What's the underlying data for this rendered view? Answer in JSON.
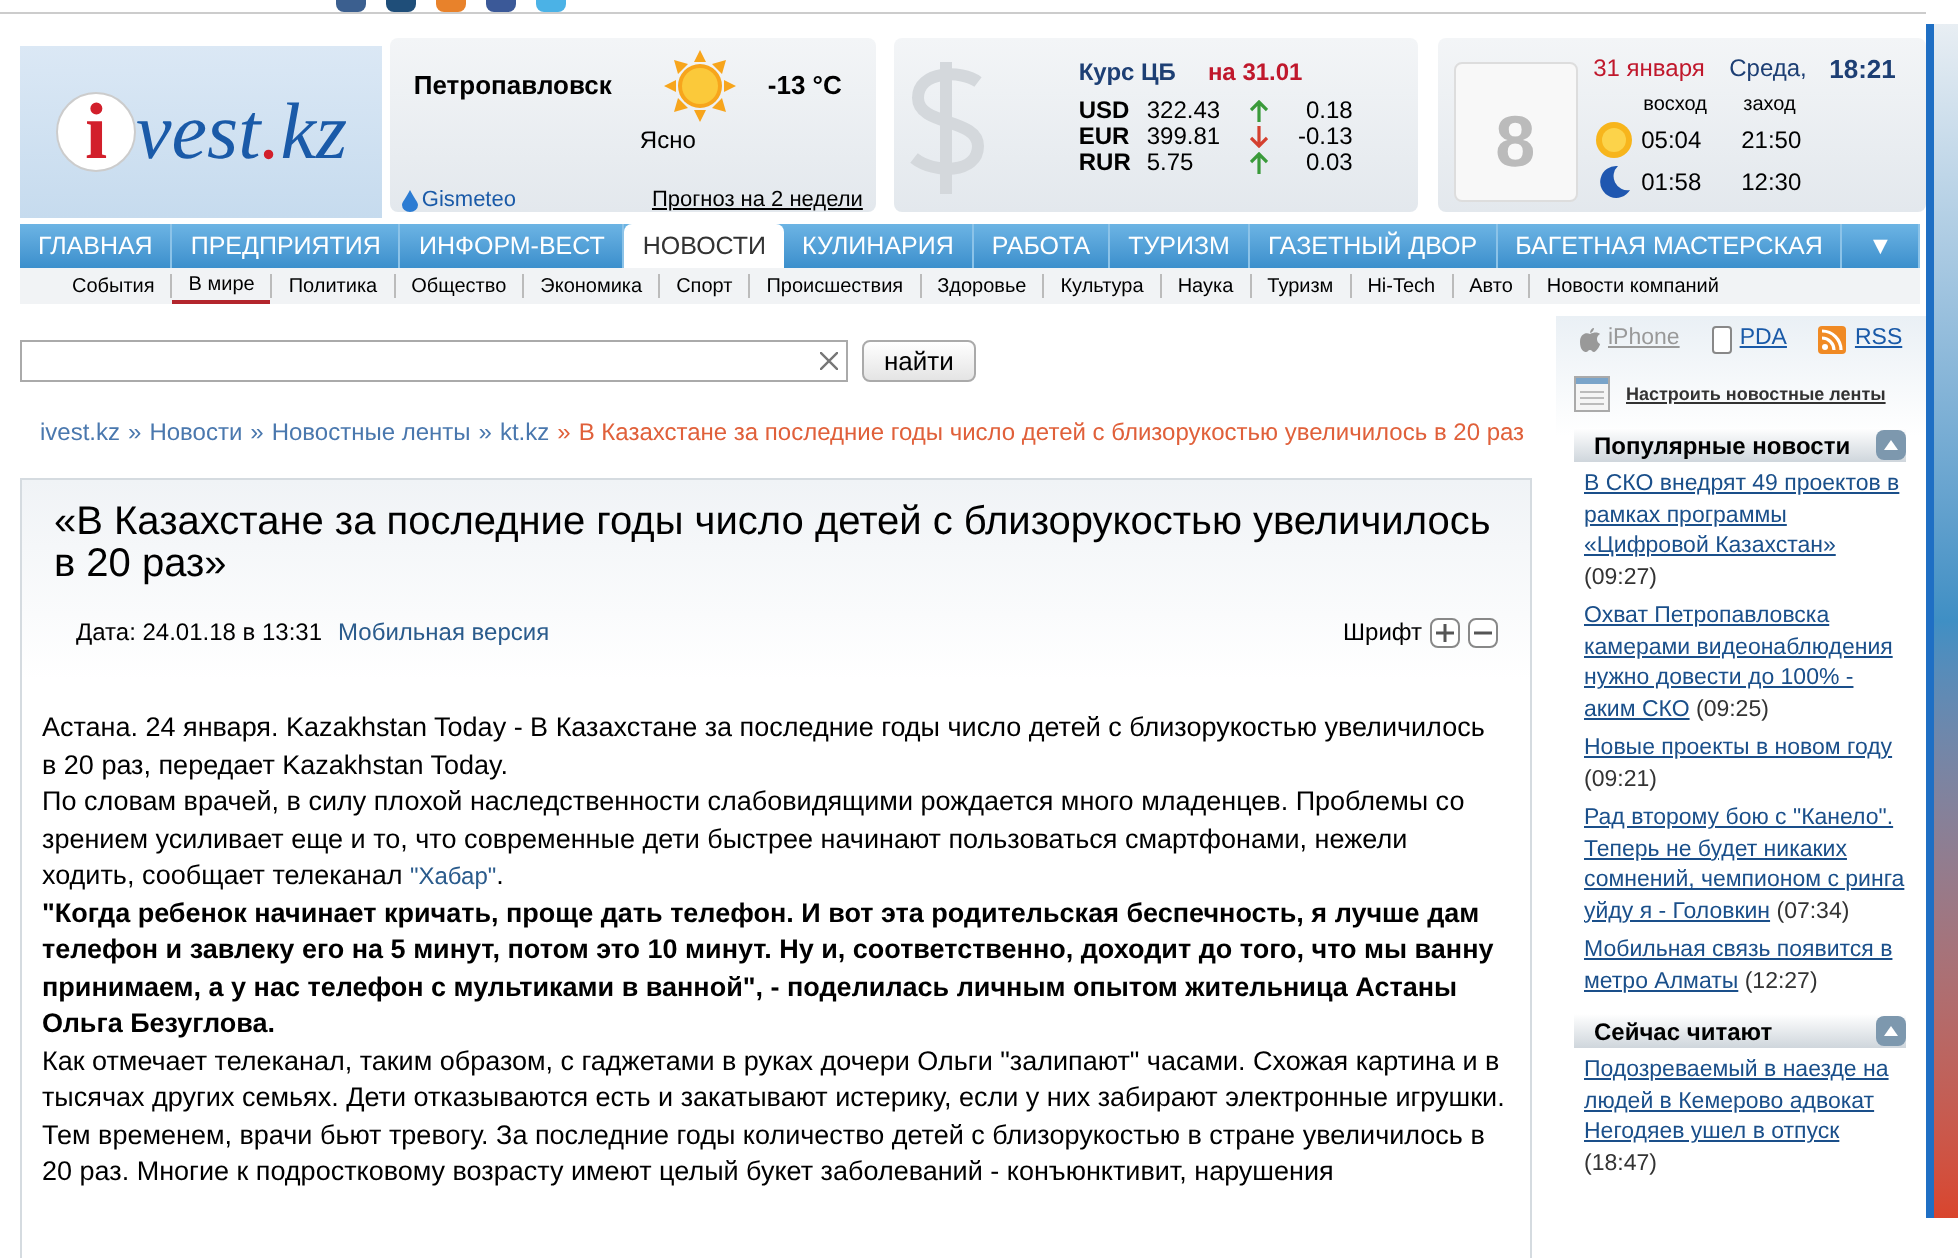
{
  "logo": {
    "mark": "i",
    "name": "vest",
    "dot": ".",
    "tld": "kz"
  },
  "weather": {
    "city": "Петропавловск",
    "temperature": "-13 °C",
    "condition": "Ясно",
    "source": "Gismeteo",
    "forecast_link": "Прогноз на 2 недели"
  },
  "currency": {
    "title": "Курс ЦБ",
    "date": "на 31.01",
    "rows": [
      {
        "code": "USD",
        "rate": "322.43",
        "rising": true,
        "change": "0.18"
      },
      {
        "code": "EUR",
        "rate": "399.81",
        "rising": false,
        "change": "-0.13"
      },
      {
        "code": "RUR",
        "rate": "5.75",
        "rising": true,
        "change": "0.03"
      }
    ]
  },
  "calendar": {
    "day": "8",
    "date": "31 января",
    "weekday": "Среда,",
    "time": "18:21",
    "rise_label": "восход",
    "set_label": "заход",
    "sun": {
      "rise": "05:04",
      "set": "21:50"
    },
    "moon": {
      "rise": "01:58",
      "set": "12:30"
    }
  },
  "nav_tabs": [
    {
      "label": "ГЛАВНАЯ",
      "selected": false
    },
    {
      "label": "ПРЕДПРИЯТИЯ",
      "selected": false
    },
    {
      "label": "ИНФОРМ-ВЕСТ",
      "selected": false
    },
    {
      "label": "НОВОСТИ",
      "selected": true
    },
    {
      "label": "КУЛИНАРИЯ",
      "selected": false
    },
    {
      "label": "РАБОТА",
      "selected": false
    },
    {
      "label": "ТУРИЗМ",
      "selected": false
    },
    {
      "label": "ГАЗЕТНЫЙ ДВОР",
      "selected": false
    },
    {
      "label": "БАГЕТНАЯ МАСТЕРСКАЯ",
      "selected": false
    },
    {
      "label": "▼",
      "selected": false
    }
  ],
  "sub_nav": [
    {
      "label": "События",
      "selected": false
    },
    {
      "label": "В мире",
      "selected": true
    },
    {
      "label": "Политика",
      "selected": false
    },
    {
      "label": "Общество",
      "selected": false
    },
    {
      "label": "Экономика",
      "selected": false
    },
    {
      "label": "Спорт",
      "selected": false
    },
    {
      "label": "Происшествия",
      "selected": false
    },
    {
      "label": "Здоровье",
      "selected": false
    },
    {
      "label": "Культура",
      "selected": false
    },
    {
      "label": "Наука",
      "selected": false
    },
    {
      "label": "Туризм",
      "selected": false
    },
    {
      "label": "Hi-Tech",
      "selected": false
    },
    {
      "label": "Авто",
      "selected": false
    },
    {
      "label": "Новости компаний",
      "selected": false
    }
  ],
  "search": {
    "button": "найти"
  },
  "breadcrumb": [
    {
      "label": "ivest.kz",
      "kind": "link"
    },
    {
      "label": "Новости",
      "kind": "link"
    },
    {
      "label": "Новостные ленты",
      "kind": "link"
    },
    {
      "label": "kt.kz",
      "kind": "link"
    },
    {
      "label": "В Казахстане за последние годы число детей с близорукостью увеличилось в 20 раз",
      "kind": "current"
    }
  ],
  "breadcrumb_separator": "»",
  "article": {
    "title": "«В Казахстане за последние годы число детей с близорукостью увеличилось в 20 раз»",
    "date": "Дата: 24.01.18 в 13:31",
    "mobile_link": "Мобильная версия",
    "font_label": "Шрифт",
    "paragraphs": [
      {
        "kind": "text",
        "text": "Астана. 24 января. Kazakhstan Today - В Казахстане за последние годы число детей с близорукостью увеличилось в 20 раз, передает Kazakhstan Today."
      },
      {
        "kind": "link_text",
        "text": "По словам врачей, в силу плохой наследственности слабовидящими рождается много младенцев. Проблемы со зрением усиливает еще и то, что современные дети быстрее начинают пользоваться смартфонами, нежели ходить, сообщает телеканал ",
        "link": "\"Хабар\"",
        "tail": "."
      },
      {
        "kind": "bold",
        "text": "\"Когда ребенок начинает кричать, проще дать телефон. И вот эта родительская беспечность, я лучше дам телефон и завлеку его на 5 минут, потом это 10 минут. Ну и, соответственно, доходит до того, что мы ванну принимаем, а у нас телефон с мультиками в ванной\", - поделилась личным опытом жительница Астаны Ольга Безуглова."
      },
      {
        "kind": "text",
        "text": "Как отмечает телеканал, таким образом, с гаджетами в руках дочери Ольги \"залипают\" часами. Схожая картина и в тысячах других семьях. Дети отказываются есть и закатывают истерику, если у них забирают электронные игрушки."
      },
      {
        "kind": "text",
        "text": "Тем временем, врачи бьют тревогу. За последние годы количество детей с близорукостью в стране увеличилось в 20 раз. Многие к подростковому возрасту имеют целый букет заболеваний - конъюнктивит, нарушения"
      }
    ]
  },
  "sidebar": {
    "links": [
      {
        "label": "iPhone",
        "kind": "iphone"
      },
      {
        "label": "PDA",
        "kind": "pda"
      },
      {
        "label": "RSS",
        "kind": "rss"
      }
    ],
    "settings_link": "Настроить новостные ленты",
    "sections": [
      {
        "title": "Популярные новости",
        "items": [
          {
            "title": "В СКО внедрят 49 проектов в рамках программы «Цифровой Казахстан»",
            "time": "(09:27)"
          },
          {
            "title": "Охват Петропавловска камерами видеонаблюдения нужно довести до 100% - аким СКО",
            "time": "(09:25)"
          },
          {
            "title": "Новые проекты в новом году",
            "time": "(09:21)"
          },
          {
            "title": "Рад второму бою с \"Канело\". Теперь не будет никаких сомнений, чемпионом с ринга уйду я - Головкин",
            "time": "(07:34)"
          },
          {
            "title": "Мобильная связь появится в метро Алматы",
            "time": "(12:27)"
          }
        ]
      },
      {
        "title": "Сейчас читают",
        "items": [
          {
            "title": "Подозреваемый в наезде на людей в Кемерово адвокат Негодяев ушел в отпуск",
            "time": "(18:47)"
          }
        ]
      }
    ]
  }
}
